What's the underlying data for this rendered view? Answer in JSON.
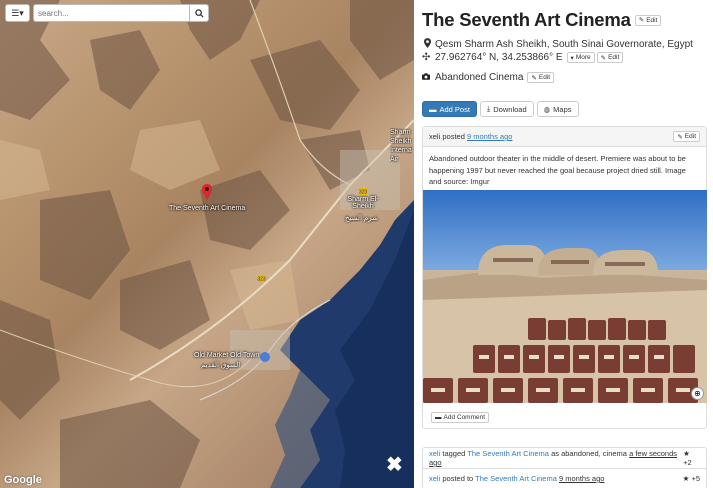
{
  "map": {
    "search_placeholder": "search...",
    "pin_label": "The Seventh Art Cinema",
    "labels": {
      "sharm_el_sheikh": "Sharm El-Sheikh",
      "sharm_el_sheikh_ar": "شرم الشيخ",
      "old_market": "Old Market Old Town",
      "old_market_ar": "السوق القديم",
      "airport": "Sharm Sheikh Internat Air",
      "road_323a": "323",
      "road_323b": "323"
    },
    "attribution": "Google",
    "icons": {
      "layers": "list-icon",
      "search": "search-icon",
      "close": "close-icon",
      "pin": "map-pin-icon"
    }
  },
  "place": {
    "title": "The Seventh Art Cinema",
    "edit_label": "Edit",
    "location": "Qesm Sharm Ash Sheikh, South Sinai Governorate, Egypt",
    "coordinates": "27.962764° N, 34.253866° E",
    "more_label": "More",
    "coord_edit_label": "Edit",
    "category": "Abandoned Cinema",
    "category_edit_label": "Edit"
  },
  "actions": {
    "add_post": "Add Post",
    "download": "Download",
    "maps": "Maps"
  },
  "post": {
    "author": "xeli",
    "posted_text": "posted",
    "time": "9 months ago",
    "edit_label": "Edit",
    "body": "Abandoned outdoor theater in the middle of desert. Premiere was about to be happening 1997 but never reached the goal because project dried still. Image and source:",
    "link": "Imgur",
    "add_comment": "Add Comment"
  },
  "feed": [
    {
      "user": "xeli",
      "verb": "tagged",
      "place": "The Seventh Art Cinema",
      "rest": "as abandoned, cinema",
      "time": "a few seconds ago",
      "votes": "+2"
    },
    {
      "user": "xeli",
      "verb": "posted to",
      "place": "The Seventh Art Cinema",
      "rest": "",
      "time": "9 months ago",
      "votes": "+5"
    }
  ],
  "colors": {
    "primary": "#337ab7",
    "link": "#337ab7",
    "pin": "#d9282f"
  }
}
